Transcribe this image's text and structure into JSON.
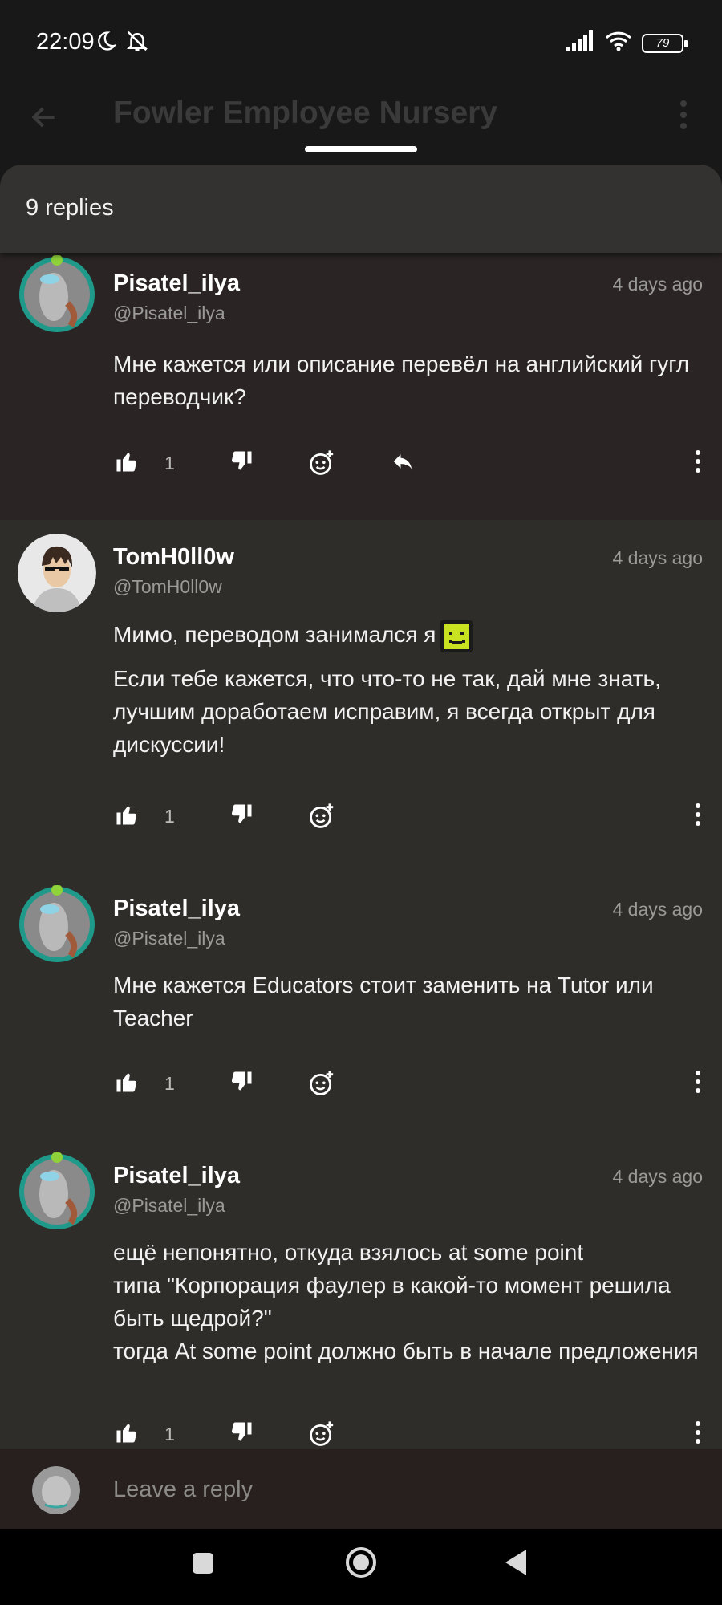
{
  "status_bar": {
    "time": "22:09",
    "battery": "79"
  },
  "app_bar": {
    "title": "Fowler Employee Nursery"
  },
  "sheet": {
    "replies_count": "9 replies"
  },
  "comments": [
    {
      "username": "Pisatel_ilya",
      "handle": "@Pisatel_ilya",
      "time": "4 days ago",
      "paragraphs": [
        "Мне кажется или описание перевёл на английский гугл переводчик?"
      ],
      "likes": "1",
      "highlighted": true
    },
    {
      "username": "TomH0ll0w",
      "handle": "@TomH0ll0w",
      "time": "4 days ago",
      "paragraphs": [
        "Мимо, переводом занимался я",
        "Если тебе кажется, что что-то не так, дай мне знать, лучшим доработаем исправим, я всегда открыт для дискуссии!"
      ],
      "likes": "1",
      "highlighted": false
    },
    {
      "username": "Pisatel_ilya",
      "handle": "@Pisatel_ilya",
      "time": "4 days ago",
      "paragraphs": [
        "Мне кажется Educators стоит заменить на Tutor или Teacher"
      ],
      "likes": "1",
      "highlighted": false
    },
    {
      "username": "Pisatel_ilya",
      "handle": "@Pisatel_ilya",
      "time": "4 days ago",
      "paragraphs": [
        "ещё непонятно, откуда взялось at some point",
        "типа \"Корпорация фаулер в какой-то момент решила быть щедрой?\"",
        "тогда At some point должно быть в начале предложения"
      ],
      "likes": "1",
      "highlighted": false
    }
  ],
  "reply_bar": {
    "placeholder": "Leave a reply"
  },
  "colors": {
    "sheet_background": "#2e2d29",
    "highlighted_comment": "#2a2524",
    "emote": "#c8e221"
  }
}
